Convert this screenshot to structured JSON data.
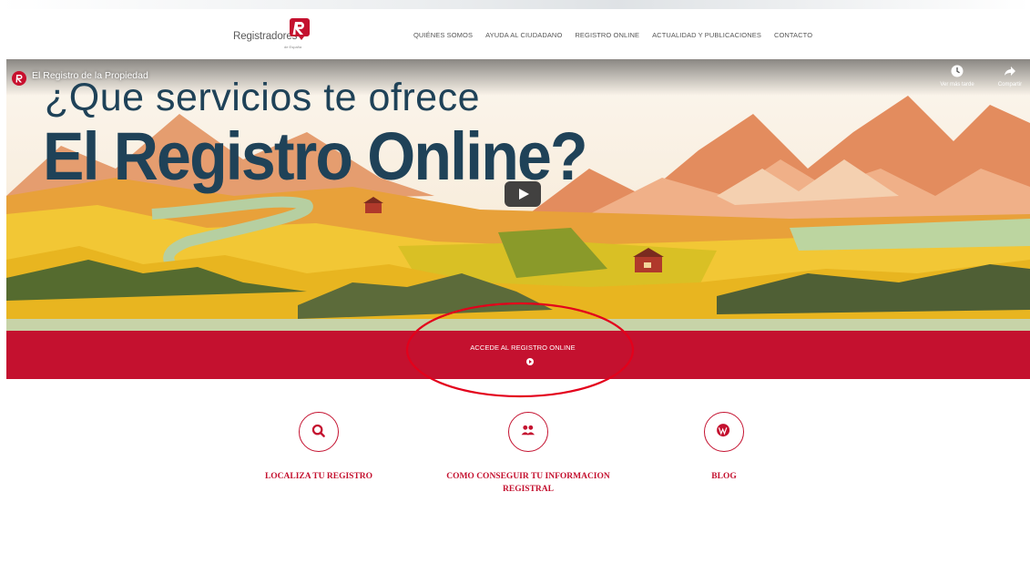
{
  "header": {
    "logo_text": "Registradores",
    "logo_sub": "de España",
    "nav": [
      "QUIÉNES SOMOS",
      "AYUDA AL CIUDADANO",
      "REGISTRO ONLINE",
      "ACTUALIDAD Y PUBLICACIONES",
      "CONTACTO"
    ]
  },
  "video": {
    "title": "El Registro de la Propiedad",
    "headline_line1": "¿Que servicios te ofrece",
    "headline_line2": "El Registro Online?",
    "watch_later_label": "Ver más tarde",
    "share_label": "Compartir",
    "icons": [
      "youtube-channel-icon",
      "clock-icon",
      "share-icon",
      "play-icon"
    ]
  },
  "cta": {
    "label": "ACCEDE AL REGISTRO ONLINE",
    "arrow_icon": "arrow-circle-right-icon"
  },
  "features": [
    {
      "label_line1": "LOCALIZA TU REGISTRO",
      "label_line2": "",
      "icon": "search-icon"
    },
    {
      "label_line1": "COMO CONSEGUIR TU INFORMACION",
      "label_line2": "REGISTRAL",
      "icon": "users-icon"
    },
    {
      "label_line1": "BLOG",
      "label_line2": "",
      "icon": "wordpress-icon"
    }
  ],
  "colors": {
    "brand_red": "#c4112f",
    "headline_navy": "#1f4258",
    "annotation_red": "#e3001b"
  }
}
